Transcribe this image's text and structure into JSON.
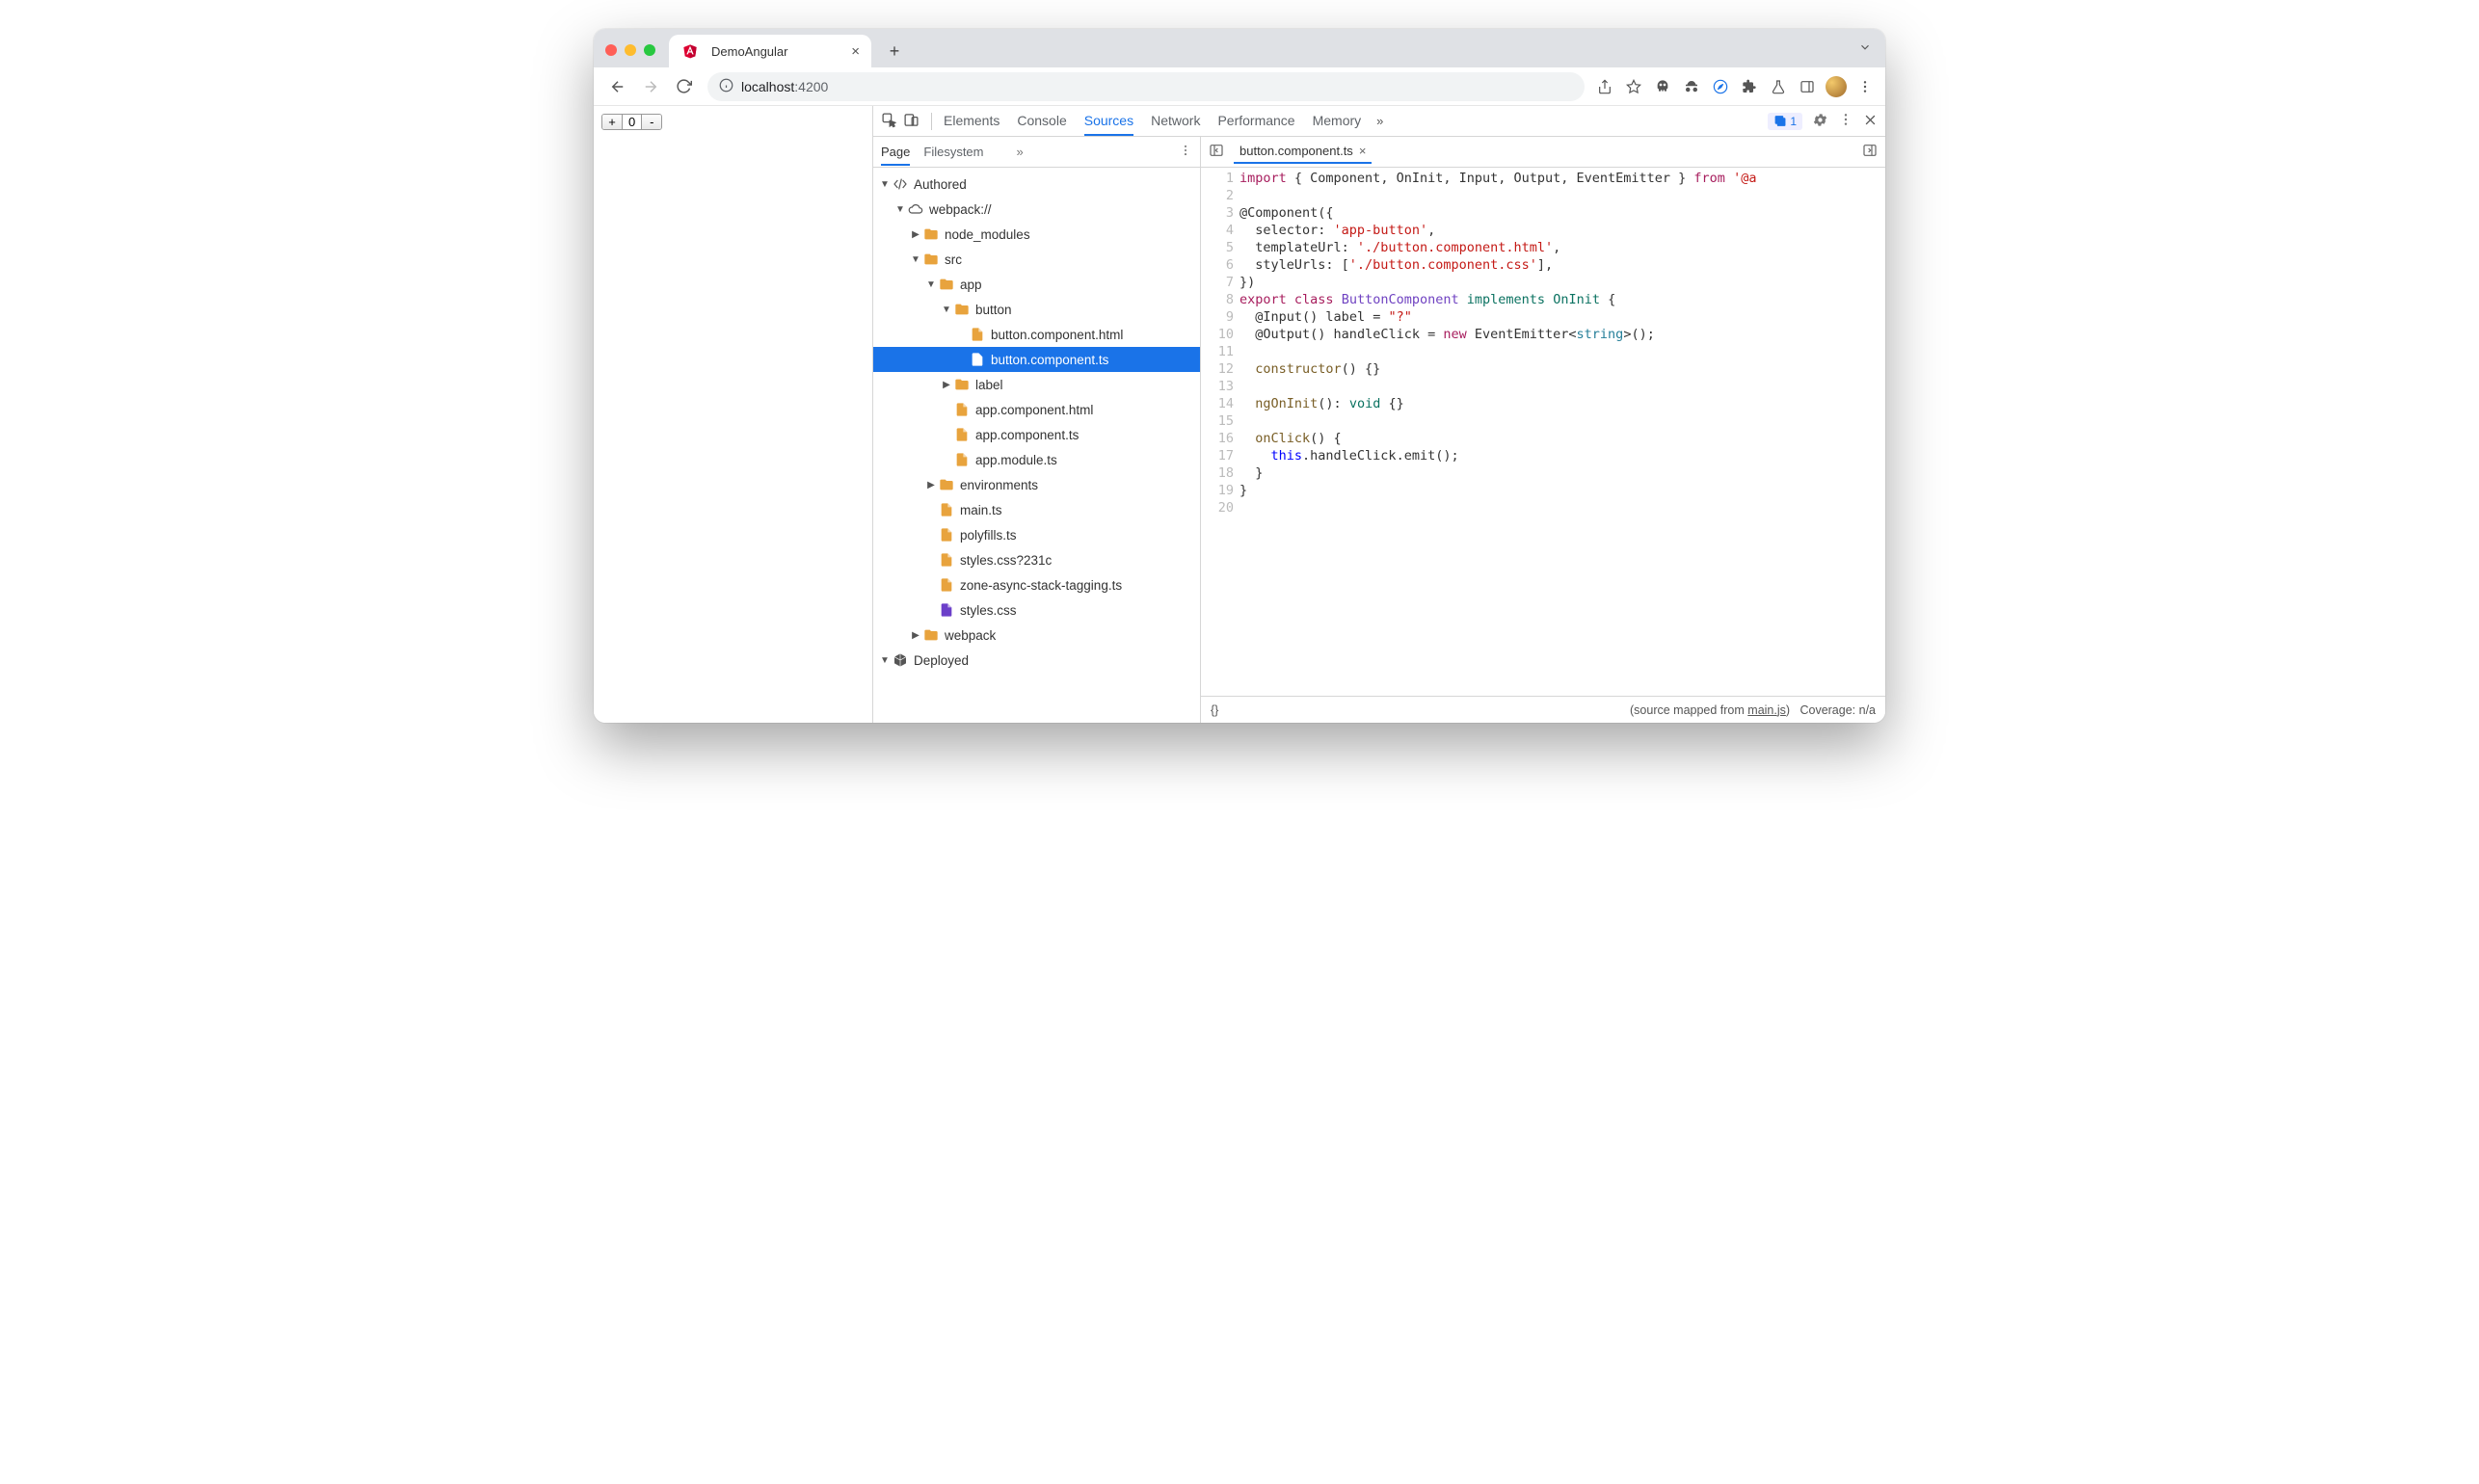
{
  "browser": {
    "tab_title": "DemoAngular",
    "url_host": "localhost",
    "url_port": ":4200",
    "toolbar_icons": [
      "share-icon",
      "star-icon",
      "skull-icon",
      "incognito-icon",
      "compass-icon",
      "puzzle-icon",
      "flask-icon",
      "panel-icon"
    ],
    "counter_value": "0"
  },
  "devtools": {
    "tabs": [
      "Elements",
      "Console",
      "Sources",
      "Network",
      "Performance",
      "Memory"
    ],
    "active_tab": "Sources",
    "issues_count": "1",
    "subtabs": [
      "Page",
      "Filesystem"
    ],
    "active_subtab": "Page",
    "open_file": "button.component.ts",
    "status_left": "{}",
    "status_mapped_prefix": "(source mapped from ",
    "status_mapped_link": "main.js",
    "status_mapped_suffix": ")",
    "status_coverage": "Coverage: n/a"
  },
  "tree": [
    {
      "depth": 0,
      "arrow": "▼",
      "icon": "author",
      "label": "Authored"
    },
    {
      "depth": 1,
      "arrow": "▼",
      "icon": "cloud",
      "label": "webpack://"
    },
    {
      "depth": 2,
      "arrow": "▶",
      "icon": "folder",
      "label": "node_modules"
    },
    {
      "depth": 2,
      "arrow": "▼",
      "icon": "folder",
      "label": "src"
    },
    {
      "depth": 3,
      "arrow": "▼",
      "icon": "folder",
      "label": "app"
    },
    {
      "depth": 4,
      "arrow": "▼",
      "icon": "folder",
      "label": "button"
    },
    {
      "depth": 5,
      "arrow": "",
      "icon": "file",
      "label": "button.component.html"
    },
    {
      "depth": 5,
      "arrow": "",
      "icon": "file",
      "label": "button.component.ts",
      "selected": true
    },
    {
      "depth": 4,
      "arrow": "▶",
      "icon": "folder",
      "label": "label"
    },
    {
      "depth": 4,
      "arrow": "",
      "icon": "file",
      "label": "app.component.html"
    },
    {
      "depth": 4,
      "arrow": "",
      "icon": "file",
      "label": "app.component.ts"
    },
    {
      "depth": 4,
      "arrow": "",
      "icon": "file",
      "label": "app.module.ts"
    },
    {
      "depth": 3,
      "arrow": "▶",
      "icon": "folder",
      "label": "environments"
    },
    {
      "depth": 3,
      "arrow": "",
      "icon": "file",
      "label": "main.ts"
    },
    {
      "depth": 3,
      "arrow": "",
      "icon": "file",
      "label": "polyfills.ts"
    },
    {
      "depth": 3,
      "arrow": "",
      "icon": "file",
      "label": "styles.css?231c"
    },
    {
      "depth": 3,
      "arrow": "",
      "icon": "file",
      "label": "zone-async-stack-tagging.ts"
    },
    {
      "depth": 3,
      "arrow": "",
      "icon": "file-purple",
      "label": "styles.css"
    },
    {
      "depth": 2,
      "arrow": "▶",
      "icon": "folder",
      "label": "webpack"
    },
    {
      "depth": 0,
      "arrow": "▼",
      "icon": "deploy",
      "label": "Deployed"
    }
  ],
  "code": {
    "lines": [
      [
        [
          "tok-imp",
          "import"
        ],
        [
          "tok-punc",
          " { Component, OnInit, Input, Output, EventEmitter } "
        ],
        [
          "tok-imp",
          "from"
        ],
        [
          "tok-punc",
          " "
        ],
        [
          "tok-str",
          "'@a"
        ]
      ],
      [
        [
          "tok-punc",
          ""
        ]
      ],
      [
        [
          "tok-dec",
          "@Component"
        ],
        [
          "tok-punc",
          "({"
        ]
      ],
      [
        [
          "tok-punc",
          "  selector: "
        ],
        [
          "tok-str",
          "'app-button'"
        ],
        [
          "tok-punc",
          ","
        ]
      ],
      [
        [
          "tok-punc",
          "  templateUrl: "
        ],
        [
          "tok-str",
          "'./button.component.html'"
        ],
        [
          "tok-punc",
          ","
        ]
      ],
      [
        [
          "tok-punc",
          "  styleUrls: ["
        ],
        [
          "tok-str",
          "'./button.component.css'"
        ],
        [
          "tok-punc",
          "],"
        ]
      ],
      [
        [
          "tok-punc",
          "})"
        ]
      ],
      [
        [
          "tok-kw",
          "export"
        ],
        [
          "tok-punc",
          " "
        ],
        [
          "tok-kw",
          "class"
        ],
        [
          "tok-punc",
          " "
        ],
        [
          "tok-class",
          "ButtonComponent"
        ],
        [
          "tok-punc",
          " "
        ],
        [
          "tok-type",
          "implements"
        ],
        [
          "tok-punc",
          " "
        ],
        [
          "tok-type",
          "OnInit"
        ],
        [
          "tok-punc",
          " {"
        ]
      ],
      [
        [
          "tok-punc",
          "  "
        ],
        [
          "tok-dec",
          "@Input"
        ],
        [
          "tok-punc",
          "() label = "
        ],
        [
          "tok-str",
          "\"?\""
        ]
      ],
      [
        [
          "tok-punc",
          "  "
        ],
        [
          "tok-dec",
          "@Output"
        ],
        [
          "tok-punc",
          "() handleClick = "
        ],
        [
          "tok-new",
          "new"
        ],
        [
          "tok-punc",
          " EventEmitter<"
        ],
        [
          "tok-gen",
          "string"
        ],
        [
          "tok-punc",
          ">();"
        ]
      ],
      [
        [
          "tok-punc",
          ""
        ]
      ],
      [
        [
          "tok-punc",
          "  "
        ],
        [
          "tok-fn",
          "constructor"
        ],
        [
          "tok-punc",
          "() {}"
        ]
      ],
      [
        [
          "tok-punc",
          ""
        ]
      ],
      [
        [
          "tok-punc",
          "  "
        ],
        [
          "tok-fn",
          "ngOnInit"
        ],
        [
          "tok-punc",
          "(): "
        ],
        [
          "tok-type",
          "void"
        ],
        [
          "tok-punc",
          " {}"
        ]
      ],
      [
        [
          "tok-punc",
          ""
        ]
      ],
      [
        [
          "tok-punc",
          "  "
        ],
        [
          "tok-fn",
          "onClick"
        ],
        [
          "tok-punc",
          "() {"
        ]
      ],
      [
        [
          "tok-punc",
          "    "
        ],
        [
          "tok-this",
          "this"
        ],
        [
          "tok-punc",
          ".handleClick.emit();"
        ]
      ],
      [
        [
          "tok-punc",
          "  }"
        ]
      ],
      [
        [
          "tok-punc",
          "}"
        ]
      ],
      [
        [
          "tok-punc",
          ""
        ]
      ]
    ]
  }
}
